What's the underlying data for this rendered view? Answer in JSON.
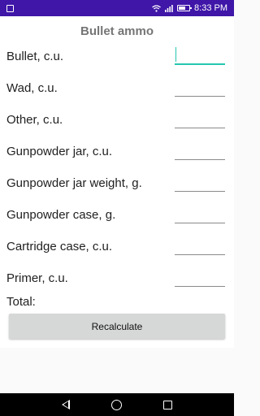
{
  "status_bar": {
    "time": "8:33 PM",
    "icons": [
      "notification-square-icon",
      "wifi-icon",
      "signal-icon",
      "battery-icon"
    ]
  },
  "screen": {
    "title": "Bullet ammo"
  },
  "fields": [
    {
      "label": "Bullet, c.u.",
      "value": ""
    },
    {
      "label": "Wad, c.u.",
      "value": ""
    },
    {
      "label": "Other, c.u.",
      "value": ""
    },
    {
      "label": "Gunpowder jar, c.u.",
      "value": ""
    },
    {
      "label": "Gunpowder jar weight, g.",
      "value": ""
    },
    {
      "label": "Gunpowder case, g.",
      "value": ""
    },
    {
      "label": "Cartridge case, c.u.",
      "value": ""
    },
    {
      "label": "Primer, c.u.",
      "value": ""
    }
  ],
  "total": {
    "label": "Total:",
    "value": ""
  },
  "recalculate_label": "Recalculate",
  "nav_bar": {
    "icons": [
      "back-icon",
      "home-icon",
      "recents-icon"
    ]
  },
  "colors": {
    "status_bar": "#3f16a8",
    "accent": "#26c6b0",
    "title": "#757575",
    "button_bg": "#d6d7d7"
  }
}
